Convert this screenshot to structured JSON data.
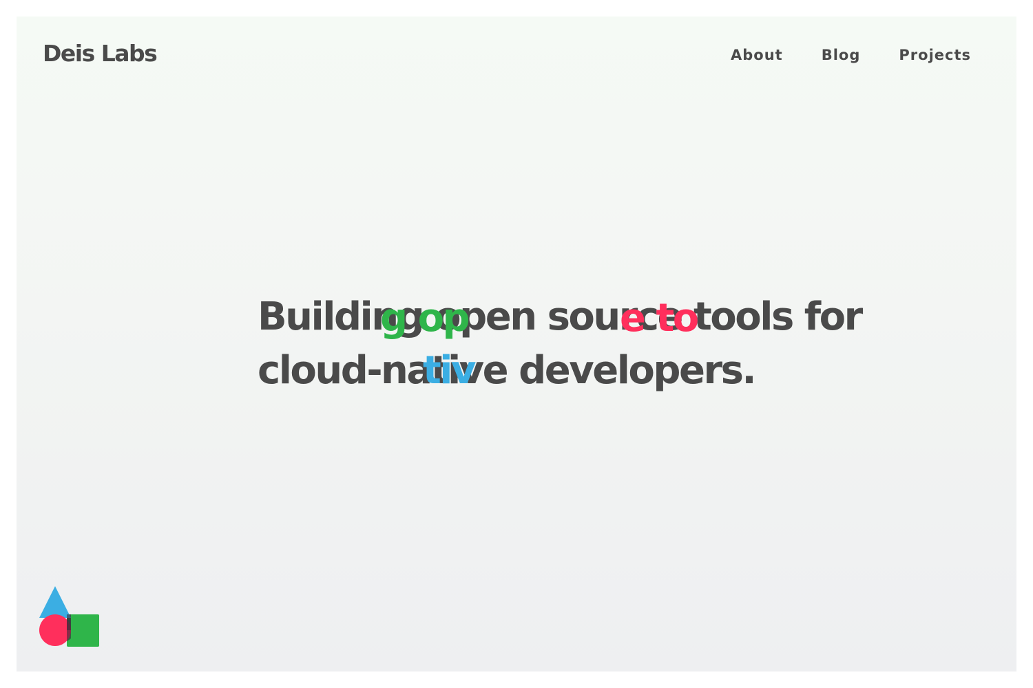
{
  "brand": {
    "name": "Deis Labs"
  },
  "nav": {
    "items": [
      "About",
      "Blog",
      "Projects"
    ]
  },
  "hero": {
    "line1": "Building open source tools for",
    "line2": "cloud-native developers.",
    "accent_fragments": {
      "green": "g op",
      "red": "e to",
      "blue": "tiv"
    }
  },
  "colors": {
    "text": "#4a4a4a",
    "green": "#2fb54a",
    "red": "#ff2f5c",
    "blue": "#3baee3",
    "background_top": "#f5faf5",
    "background_bottom": "#eeeff1"
  },
  "icons": {
    "brand_mark": "triangle-circle-square-icon"
  }
}
